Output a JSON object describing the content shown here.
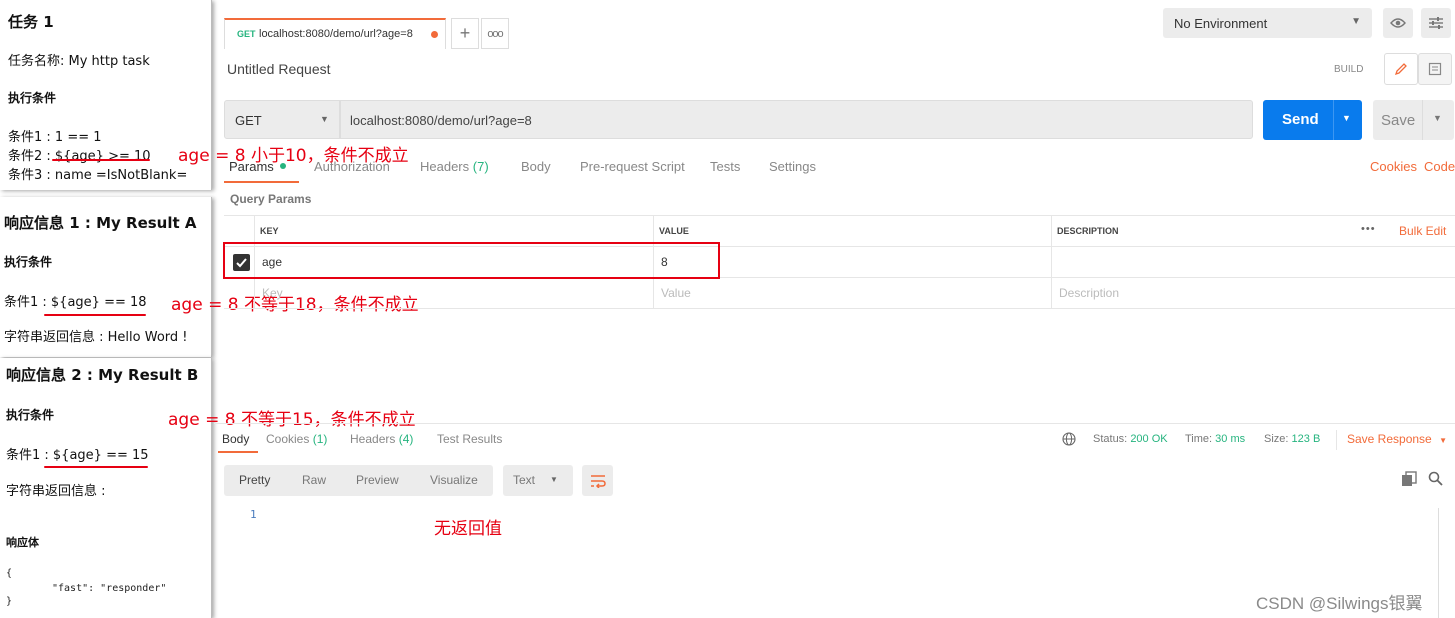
{
  "task_panel": {
    "title": "任务 1",
    "task_name": "任务名称: My http task",
    "cond_heading": "执行条件",
    "cond1": "条件1 : 1 == 1",
    "cond2": "条件2 : ${age} >= 10",
    "cond3": "条件3 : name =IsNotBlank="
  },
  "resp_a": {
    "title": "响应信息 1 : My Result A",
    "cond_heading": "执行条件",
    "cond1": "条件1 : ${age} == 18",
    "string_return": "字符串返回信息 : Hello Word !"
  },
  "resp_b": {
    "title": "响应信息 2 : My Result B",
    "cond_heading": "执行条件",
    "cond1": "条件1 : ${age} == 15",
    "string_return": "字符串返回信息 :",
    "body_heading": "响应体",
    "json_open": "{",
    "json_line": "\"fast\": \"responder\"",
    "json_close": "}"
  },
  "annotations": {
    "a1": "age = 8 小于10，条件不成立",
    "a2": "age = 8 不等于18，条件不成立",
    "a3": "age = 8 不等于15，条件不成立",
    "no_return": "无返回值"
  },
  "tab": {
    "method": "GET",
    "url": "localhost:8080/demo/url?age=8"
  },
  "env": {
    "selected": "No Environment"
  },
  "request": {
    "name": "Untitled Request",
    "build": "BUILD",
    "method": "GET",
    "url": "localhost:8080/demo/url?age=8",
    "send": "Send",
    "save": "Save"
  },
  "req_tabs": {
    "params": "Params",
    "authorization": "Authorization",
    "headers": "Headers",
    "headers_count": "(7)",
    "body": "Body",
    "prerequest": "Pre-request Script",
    "tests": "Tests",
    "settings": "Settings",
    "cookies": "Cookies",
    "code": "Code"
  },
  "params": {
    "section": "Query Params",
    "col_key": "KEY",
    "col_value": "VALUE",
    "col_desc": "DESCRIPTION",
    "bulk_edit": "Bulk Edit",
    "rows": [
      {
        "key": "age",
        "value": "8",
        "checked": true
      }
    ],
    "ph_key": "Key",
    "ph_value": "Value",
    "ph_desc": "Description"
  },
  "response": {
    "tabs": {
      "body": "Body",
      "cookies": "Cookies",
      "cookies_count": "(1)",
      "headers": "Headers",
      "headers_count": "(4)",
      "tests": "Test Results"
    },
    "status_label": "Status:",
    "status": "200 OK",
    "time_label": "Time:",
    "time": "30 ms",
    "size_label": "Size:",
    "size": "123 B",
    "save_response": "Save Response",
    "views": {
      "pretty": "Pretty",
      "raw": "Raw",
      "preview": "Preview",
      "visualize": "Visualize",
      "format": "Text"
    },
    "line_number": "1"
  },
  "watermark": "CSDN @Silwings银翼",
  "colors": {
    "accent": "#f26b3a",
    "send_blue": "#097bed",
    "green": "#26b47f",
    "annotation_red": "#e60012"
  }
}
